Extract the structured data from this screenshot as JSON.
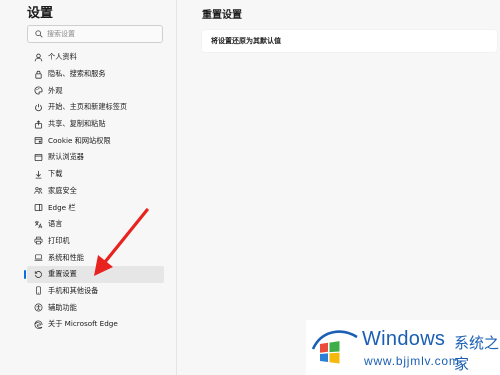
{
  "sidebar": {
    "title": "设置",
    "search_placeholder": "搜索设置",
    "items": [
      {
        "label": "个人资料",
        "icon": "profile-icon"
      },
      {
        "label": "隐私、搜索和服务",
        "icon": "lock-icon"
      },
      {
        "label": "外观",
        "icon": "palette-icon"
      },
      {
        "label": "开始、主页和新建标签页",
        "icon": "power-icon"
      },
      {
        "label": "共享、复制和粘贴",
        "icon": "share-icon"
      },
      {
        "label": "Cookie 和网站权限",
        "icon": "site-permissions-icon"
      },
      {
        "label": "默认浏览器",
        "icon": "browser-icon"
      },
      {
        "label": "下载",
        "icon": "download-icon"
      },
      {
        "label": "家庭安全",
        "icon": "family-icon"
      },
      {
        "label": "Edge 栏",
        "icon": "sidebar-icon"
      },
      {
        "label": "语言",
        "icon": "language-icon"
      },
      {
        "label": "打印机",
        "icon": "printer-icon"
      },
      {
        "label": "系统和性能",
        "icon": "laptop-icon"
      },
      {
        "label": "重置设置",
        "icon": "reset-icon",
        "active": true
      },
      {
        "label": "手机和其他设备",
        "icon": "phone-icon"
      },
      {
        "label": "辅助功能",
        "icon": "accessibility-icon"
      },
      {
        "label": "关于 Microsoft Edge",
        "icon": "edge-icon"
      }
    ]
  },
  "main": {
    "title": "重置设置",
    "reset_option": "将设置还原为其默认值"
  },
  "watermark": {
    "brand": "Windows",
    "brand_cn": "系统之家",
    "url": "www.bjjmlv.com"
  },
  "colors": {
    "accent": "#0b6ee0",
    "arrow": "#e8231f",
    "watermark_blue": "#1a5fb4"
  }
}
